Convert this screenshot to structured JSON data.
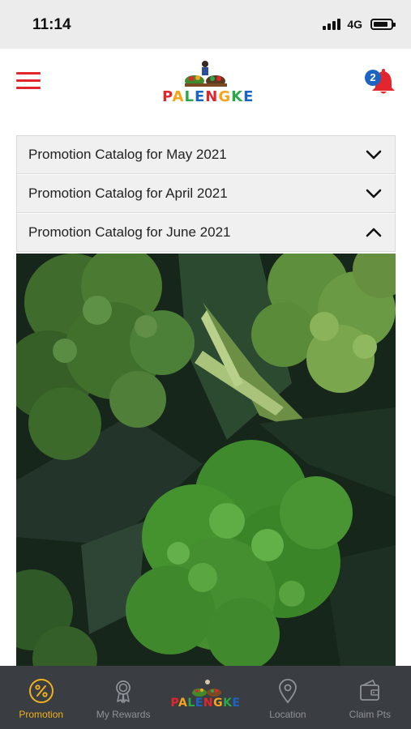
{
  "status_bar": {
    "time": "11:14",
    "network": "4G"
  },
  "header": {
    "logo_text": [
      "P",
      "A",
      "L",
      "E",
      "N",
      "G",
      "K",
      "E"
    ],
    "logo_colors": [
      "#e1262d",
      "#f4a51c",
      "#2aa84a",
      "#1c63c6",
      "#e1262d",
      "#f4a51c",
      "#2aa84a",
      "#1c63c6"
    ],
    "notification_count": "2",
    "accent_color": "#e1262d"
  },
  "accordion": {
    "items": [
      {
        "label": "Promotion Catalog for May 2021",
        "state": "collapsed"
      },
      {
        "label": "Promotion Catalog for April 2021",
        "state": "collapsed"
      },
      {
        "label": "Promotion Catalog for June 2021",
        "state": "expanded"
      }
    ]
  },
  "tab_bar": {
    "tabs": [
      {
        "label": "Promotion",
        "icon": "percent-icon",
        "active": true
      },
      {
        "label": "My Rewards",
        "icon": "award-ribbon-icon",
        "active": false
      },
      {
        "label": "",
        "icon": "palengke-logo",
        "active": false
      },
      {
        "label": "Location",
        "icon": "map-pin-icon",
        "active": false
      },
      {
        "label": "Claim Pts",
        "icon": "wallet-icon",
        "active": false
      }
    ],
    "active_color": "#f0b020",
    "inactive_color": "#8f9298"
  }
}
